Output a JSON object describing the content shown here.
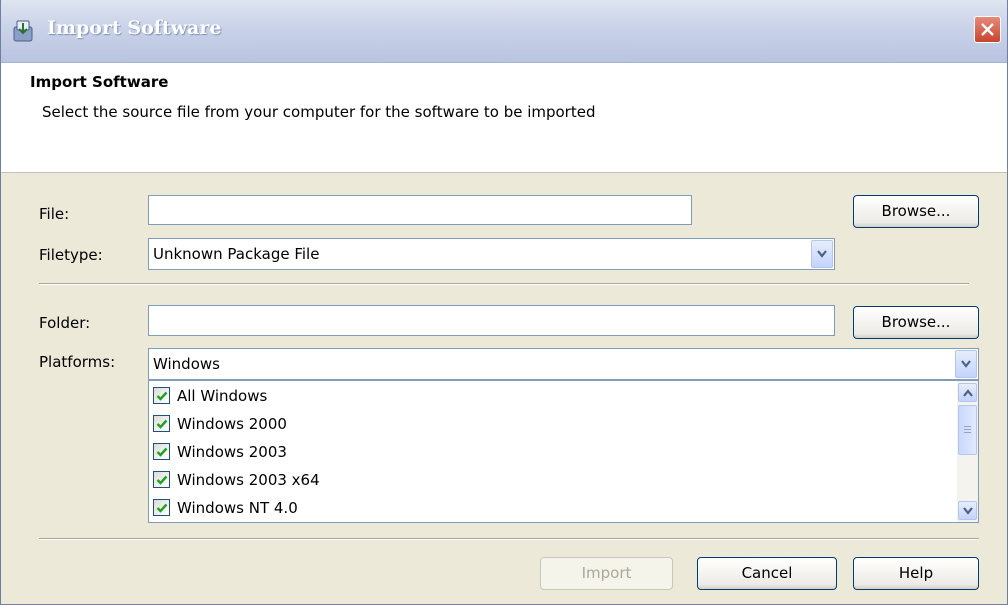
{
  "window": {
    "title": "Import Software"
  },
  "header": {
    "title": "Import Software",
    "subtitle": "Select the source file from your computer for the software to be imported"
  },
  "file_section": {
    "file_label": "File:",
    "file_value": "",
    "browse_label": "Browse...",
    "filetype_label": "Filetype:",
    "filetype_value": "Unknown Package File"
  },
  "folder_section": {
    "folder_label": "Folder:",
    "folder_value": "",
    "browse_label": "Browse...",
    "platforms_label": "Platforms:",
    "platforms_value": "Windows",
    "platform_items": [
      {
        "label": "All Windows",
        "checked": true
      },
      {
        "label": "Windows 2000",
        "checked": true
      },
      {
        "label": "Windows 2003",
        "checked": true
      },
      {
        "label": "Windows 2003 x64",
        "checked": true
      },
      {
        "label": "Windows NT 4.0",
        "checked": true
      }
    ]
  },
  "footer": {
    "import_label": "Import",
    "cancel_label": "Cancel",
    "help_label": "Help"
  },
  "icons": {
    "title": "import-software-icon",
    "close": "close-icon",
    "dropdown": "chevron-down-icon",
    "scroll_up": "chevron-up-icon",
    "scroll_down": "chevron-down-icon",
    "check": "checkmark-icon"
  },
  "colors": {
    "title_bar": "#c9d2e8",
    "dialog_bg": "#ece9d8",
    "close_red": "#c6452d",
    "check_green": "#21a121"
  }
}
